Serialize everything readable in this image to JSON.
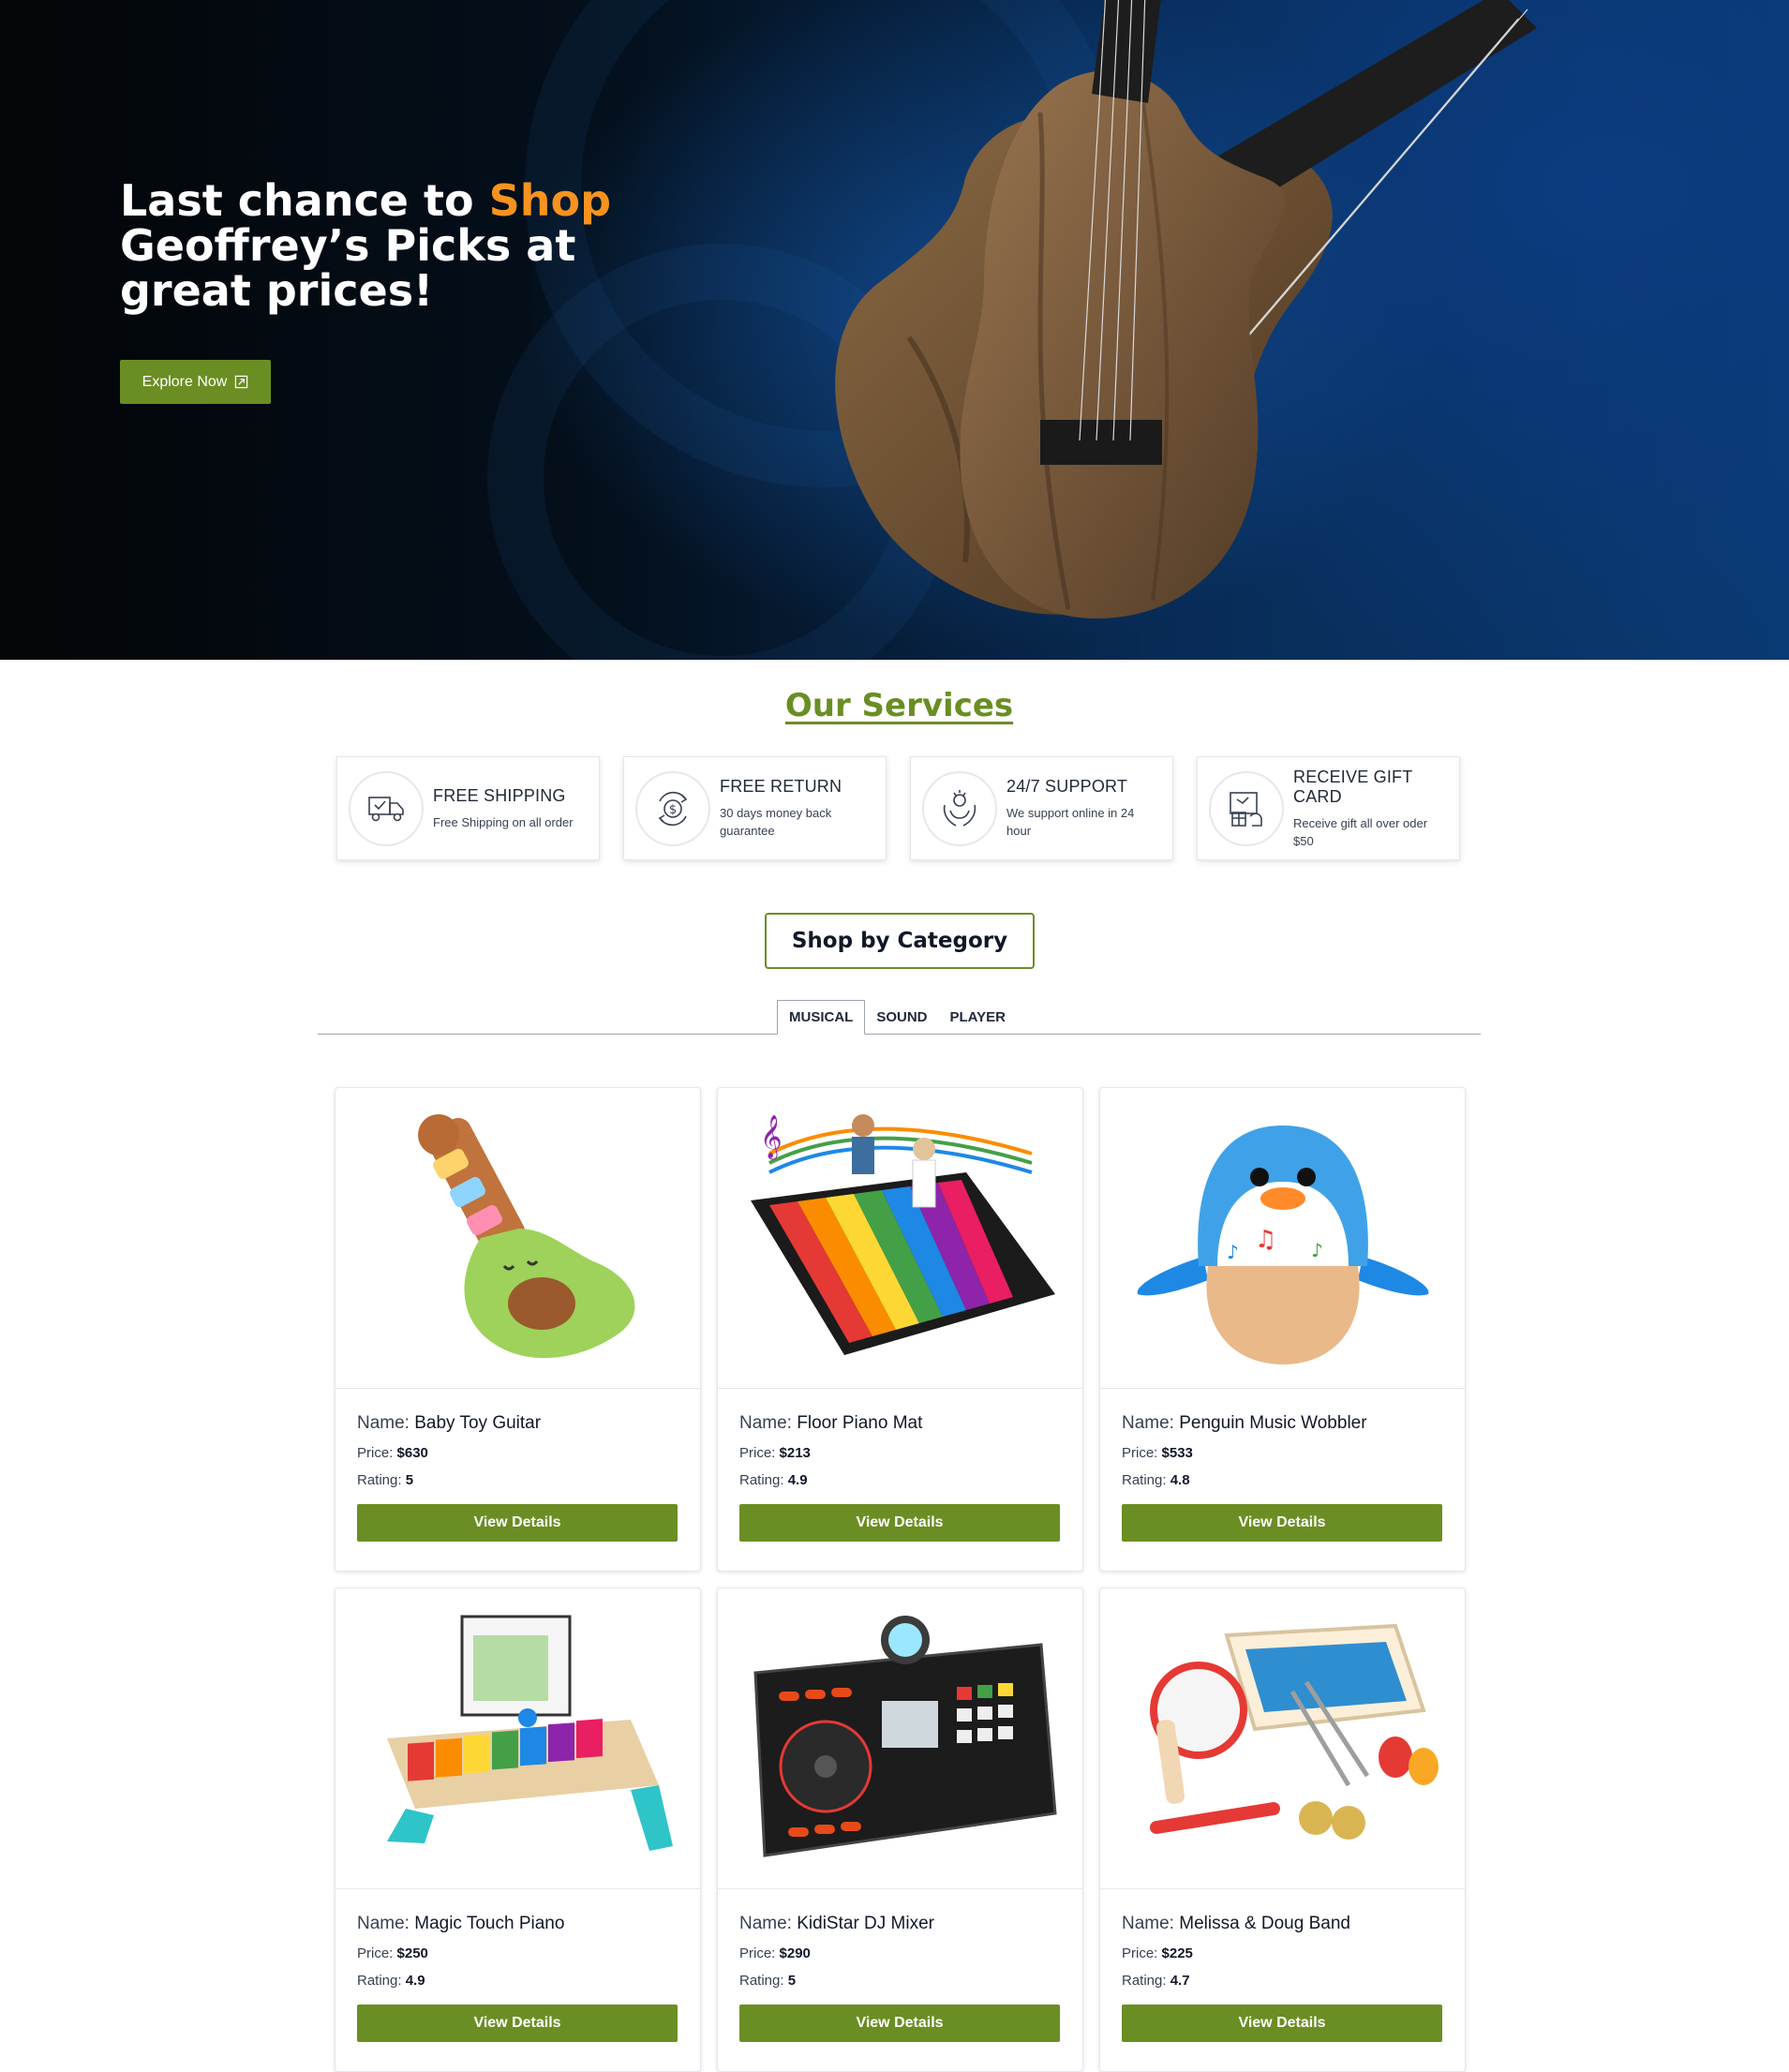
{
  "hero": {
    "title_part1": "Last chance to ",
    "title_accent": "Shop",
    "title_part2": "Geoffrey’s Picks at great prices!",
    "cta_label": "Explore Now"
  },
  "services": {
    "title": "Our Services",
    "items": [
      {
        "title": "FREE SHIPPING",
        "subtitle": "Free Shipping on all order",
        "icon": "truck-icon"
      },
      {
        "title": "FREE RETURN",
        "subtitle": "30 days money back guarantee",
        "icon": "money-return-icon"
      },
      {
        "title": "24/7 SUPPORT",
        "subtitle": "We support online in 24 hour",
        "icon": "support-hands-icon"
      },
      {
        "title": "RECEIVE GIFT CARD",
        "subtitle": "Receive gift all over oder $50",
        "icon": "gift-card-icon"
      }
    ]
  },
  "category": {
    "title": "Shop by Category",
    "tabs": [
      "MUSICAL",
      "SOUND",
      "PLAYER"
    ],
    "active_tab": "MUSICAL"
  },
  "product_labels": {
    "name": "Name: ",
    "price": "Price: ",
    "rating": "Rating: ",
    "button": "View Details"
  },
  "products": [
    {
      "name": "Baby Toy Guitar",
      "price": "$630",
      "rating": "5",
      "image": "avocado-guitar-image"
    },
    {
      "name": "Floor Piano Mat",
      "price": "$213",
      "rating": "4.9",
      "image": "floor-piano-mat-image"
    },
    {
      "name": "Penguin Music Wobbler",
      "price": "$533",
      "rating": "4.8",
      "image": "penguin-wobbler-image"
    },
    {
      "name": "Magic Touch Piano",
      "price": "$250",
      "rating": "4.9",
      "image": "toy-piano-image"
    },
    {
      "name": "KidiStar DJ Mixer",
      "price": "$290",
      "rating": "5",
      "image": "dj-mixer-image"
    },
    {
      "name": "Melissa & Doug Band",
      "price": "$225",
      "rating": "4.7",
      "image": "band-set-image"
    }
  ],
  "colors": {
    "accent_green": "#6a8e23",
    "hero_orange": "#f7931e",
    "hero_bg": "#082b55"
  }
}
